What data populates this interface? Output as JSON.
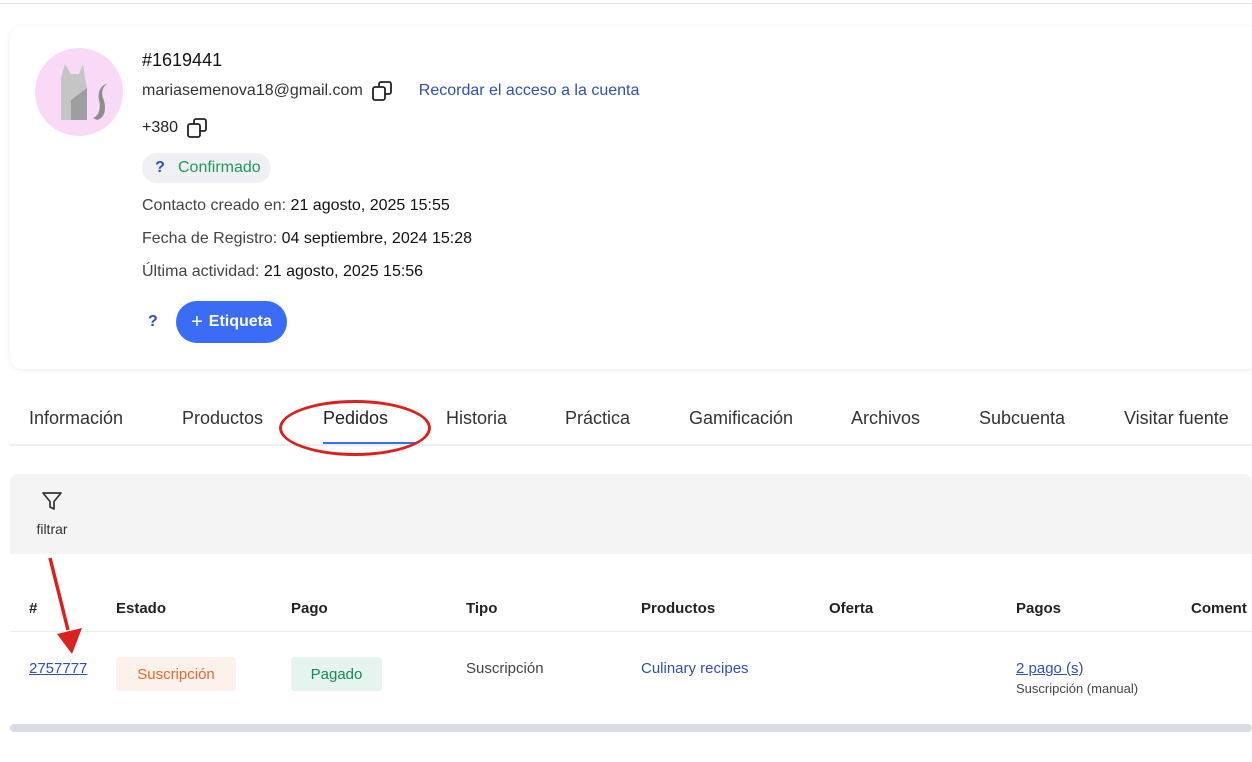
{
  "contact": {
    "id": "#1619441",
    "email": "mariasemenova18@gmail.com",
    "remind_access_label": "Recordar el acceso a la cuenta",
    "phone": "+380",
    "status": {
      "icon": "question-icon",
      "icon_text": "?",
      "label": "Confirmado",
      "color": "#1e9a5c"
    },
    "created_label": "Contacto creado en:",
    "created_value": "21 agosto, 2025 15:55",
    "registered_label": "Fecha de Registro:",
    "registered_value": "04 septiembre, 2024 15:28",
    "last_activity_label": "Última actividad:",
    "last_activity_value": "21 agosto, 2025 15:56",
    "tag_help_text": "?",
    "tag_button_plus": "+",
    "tag_button_label": "Etiqueta"
  },
  "tabs": [
    {
      "label": "Información"
    },
    {
      "label": "Productos"
    },
    {
      "label": "Pedidos",
      "active": true
    },
    {
      "label": "Historia"
    },
    {
      "label": "Práctica"
    },
    {
      "label": "Gamificación"
    },
    {
      "label": "Archivos"
    },
    {
      "label": "Subcuenta"
    },
    {
      "label": "Visitar fuente"
    }
  ],
  "filter": {
    "icon": "filter-icon",
    "label": "filtrar"
  },
  "orders_table": {
    "columns": [
      "#",
      "Estado",
      "Pago",
      "Tipo",
      "Productos",
      "Oferta",
      "Pagos",
      "Coment"
    ],
    "rows": [
      {
        "id": "2757777",
        "estado": "Suscripción",
        "pago": "Pagado",
        "tipo": "Suscripción",
        "productos": "Culinary recipes",
        "oferta": "",
        "pagos": "2 pago (s)",
        "pagos_sub": "Suscripción (manual)"
      }
    ]
  },
  "colors": {
    "accent": "#3b6cf6",
    "link": "#2f4fb2",
    "annotation_red": "#d9211f",
    "subscription_text": "#e8662f",
    "paid_text": "#188a55"
  }
}
